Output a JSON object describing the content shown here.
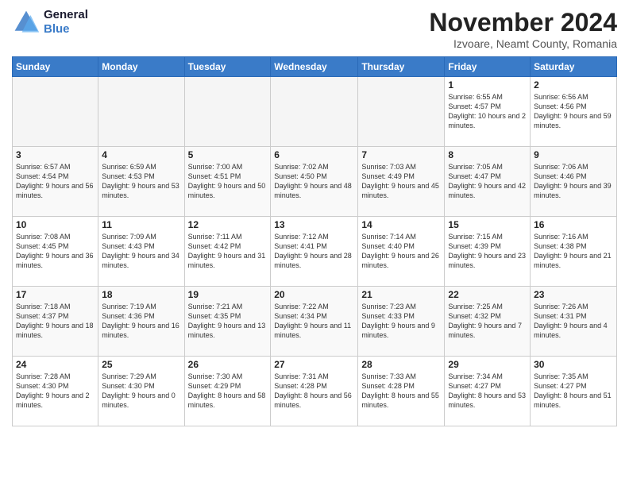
{
  "logo": {
    "line1": "General",
    "line2": "Blue"
  },
  "header": {
    "month": "November 2024",
    "location": "Izvoare, Neamt County, Romania"
  },
  "days_of_week": [
    "Sunday",
    "Monday",
    "Tuesday",
    "Wednesday",
    "Thursday",
    "Friday",
    "Saturday"
  ],
  "weeks": [
    [
      {
        "day": "",
        "info": ""
      },
      {
        "day": "",
        "info": ""
      },
      {
        "day": "",
        "info": ""
      },
      {
        "day": "",
        "info": ""
      },
      {
        "day": "",
        "info": ""
      },
      {
        "day": "1",
        "info": "Sunrise: 6:55 AM\nSunset: 4:57 PM\nDaylight: 10 hours and 2 minutes."
      },
      {
        "day": "2",
        "info": "Sunrise: 6:56 AM\nSunset: 4:56 PM\nDaylight: 9 hours and 59 minutes."
      }
    ],
    [
      {
        "day": "3",
        "info": "Sunrise: 6:57 AM\nSunset: 4:54 PM\nDaylight: 9 hours and 56 minutes."
      },
      {
        "day": "4",
        "info": "Sunrise: 6:59 AM\nSunset: 4:53 PM\nDaylight: 9 hours and 53 minutes."
      },
      {
        "day": "5",
        "info": "Sunrise: 7:00 AM\nSunset: 4:51 PM\nDaylight: 9 hours and 50 minutes."
      },
      {
        "day": "6",
        "info": "Sunrise: 7:02 AM\nSunset: 4:50 PM\nDaylight: 9 hours and 48 minutes."
      },
      {
        "day": "7",
        "info": "Sunrise: 7:03 AM\nSunset: 4:49 PM\nDaylight: 9 hours and 45 minutes."
      },
      {
        "day": "8",
        "info": "Sunrise: 7:05 AM\nSunset: 4:47 PM\nDaylight: 9 hours and 42 minutes."
      },
      {
        "day": "9",
        "info": "Sunrise: 7:06 AM\nSunset: 4:46 PM\nDaylight: 9 hours and 39 minutes."
      }
    ],
    [
      {
        "day": "10",
        "info": "Sunrise: 7:08 AM\nSunset: 4:45 PM\nDaylight: 9 hours and 36 minutes."
      },
      {
        "day": "11",
        "info": "Sunrise: 7:09 AM\nSunset: 4:43 PM\nDaylight: 9 hours and 34 minutes."
      },
      {
        "day": "12",
        "info": "Sunrise: 7:11 AM\nSunset: 4:42 PM\nDaylight: 9 hours and 31 minutes."
      },
      {
        "day": "13",
        "info": "Sunrise: 7:12 AM\nSunset: 4:41 PM\nDaylight: 9 hours and 28 minutes."
      },
      {
        "day": "14",
        "info": "Sunrise: 7:14 AM\nSunset: 4:40 PM\nDaylight: 9 hours and 26 minutes."
      },
      {
        "day": "15",
        "info": "Sunrise: 7:15 AM\nSunset: 4:39 PM\nDaylight: 9 hours and 23 minutes."
      },
      {
        "day": "16",
        "info": "Sunrise: 7:16 AM\nSunset: 4:38 PM\nDaylight: 9 hours and 21 minutes."
      }
    ],
    [
      {
        "day": "17",
        "info": "Sunrise: 7:18 AM\nSunset: 4:37 PM\nDaylight: 9 hours and 18 minutes."
      },
      {
        "day": "18",
        "info": "Sunrise: 7:19 AM\nSunset: 4:36 PM\nDaylight: 9 hours and 16 minutes."
      },
      {
        "day": "19",
        "info": "Sunrise: 7:21 AM\nSunset: 4:35 PM\nDaylight: 9 hours and 13 minutes."
      },
      {
        "day": "20",
        "info": "Sunrise: 7:22 AM\nSunset: 4:34 PM\nDaylight: 9 hours and 11 minutes."
      },
      {
        "day": "21",
        "info": "Sunrise: 7:23 AM\nSunset: 4:33 PM\nDaylight: 9 hours and 9 minutes."
      },
      {
        "day": "22",
        "info": "Sunrise: 7:25 AM\nSunset: 4:32 PM\nDaylight: 9 hours and 7 minutes."
      },
      {
        "day": "23",
        "info": "Sunrise: 7:26 AM\nSunset: 4:31 PM\nDaylight: 9 hours and 4 minutes."
      }
    ],
    [
      {
        "day": "24",
        "info": "Sunrise: 7:28 AM\nSunset: 4:30 PM\nDaylight: 9 hours and 2 minutes."
      },
      {
        "day": "25",
        "info": "Sunrise: 7:29 AM\nSunset: 4:30 PM\nDaylight: 9 hours and 0 minutes."
      },
      {
        "day": "26",
        "info": "Sunrise: 7:30 AM\nSunset: 4:29 PM\nDaylight: 8 hours and 58 minutes."
      },
      {
        "day": "27",
        "info": "Sunrise: 7:31 AM\nSunset: 4:28 PM\nDaylight: 8 hours and 56 minutes."
      },
      {
        "day": "28",
        "info": "Sunrise: 7:33 AM\nSunset: 4:28 PM\nDaylight: 8 hours and 55 minutes."
      },
      {
        "day": "29",
        "info": "Sunrise: 7:34 AM\nSunset: 4:27 PM\nDaylight: 8 hours and 53 minutes."
      },
      {
        "day": "30",
        "info": "Sunrise: 7:35 AM\nSunset: 4:27 PM\nDaylight: 8 hours and 51 minutes."
      }
    ]
  ]
}
